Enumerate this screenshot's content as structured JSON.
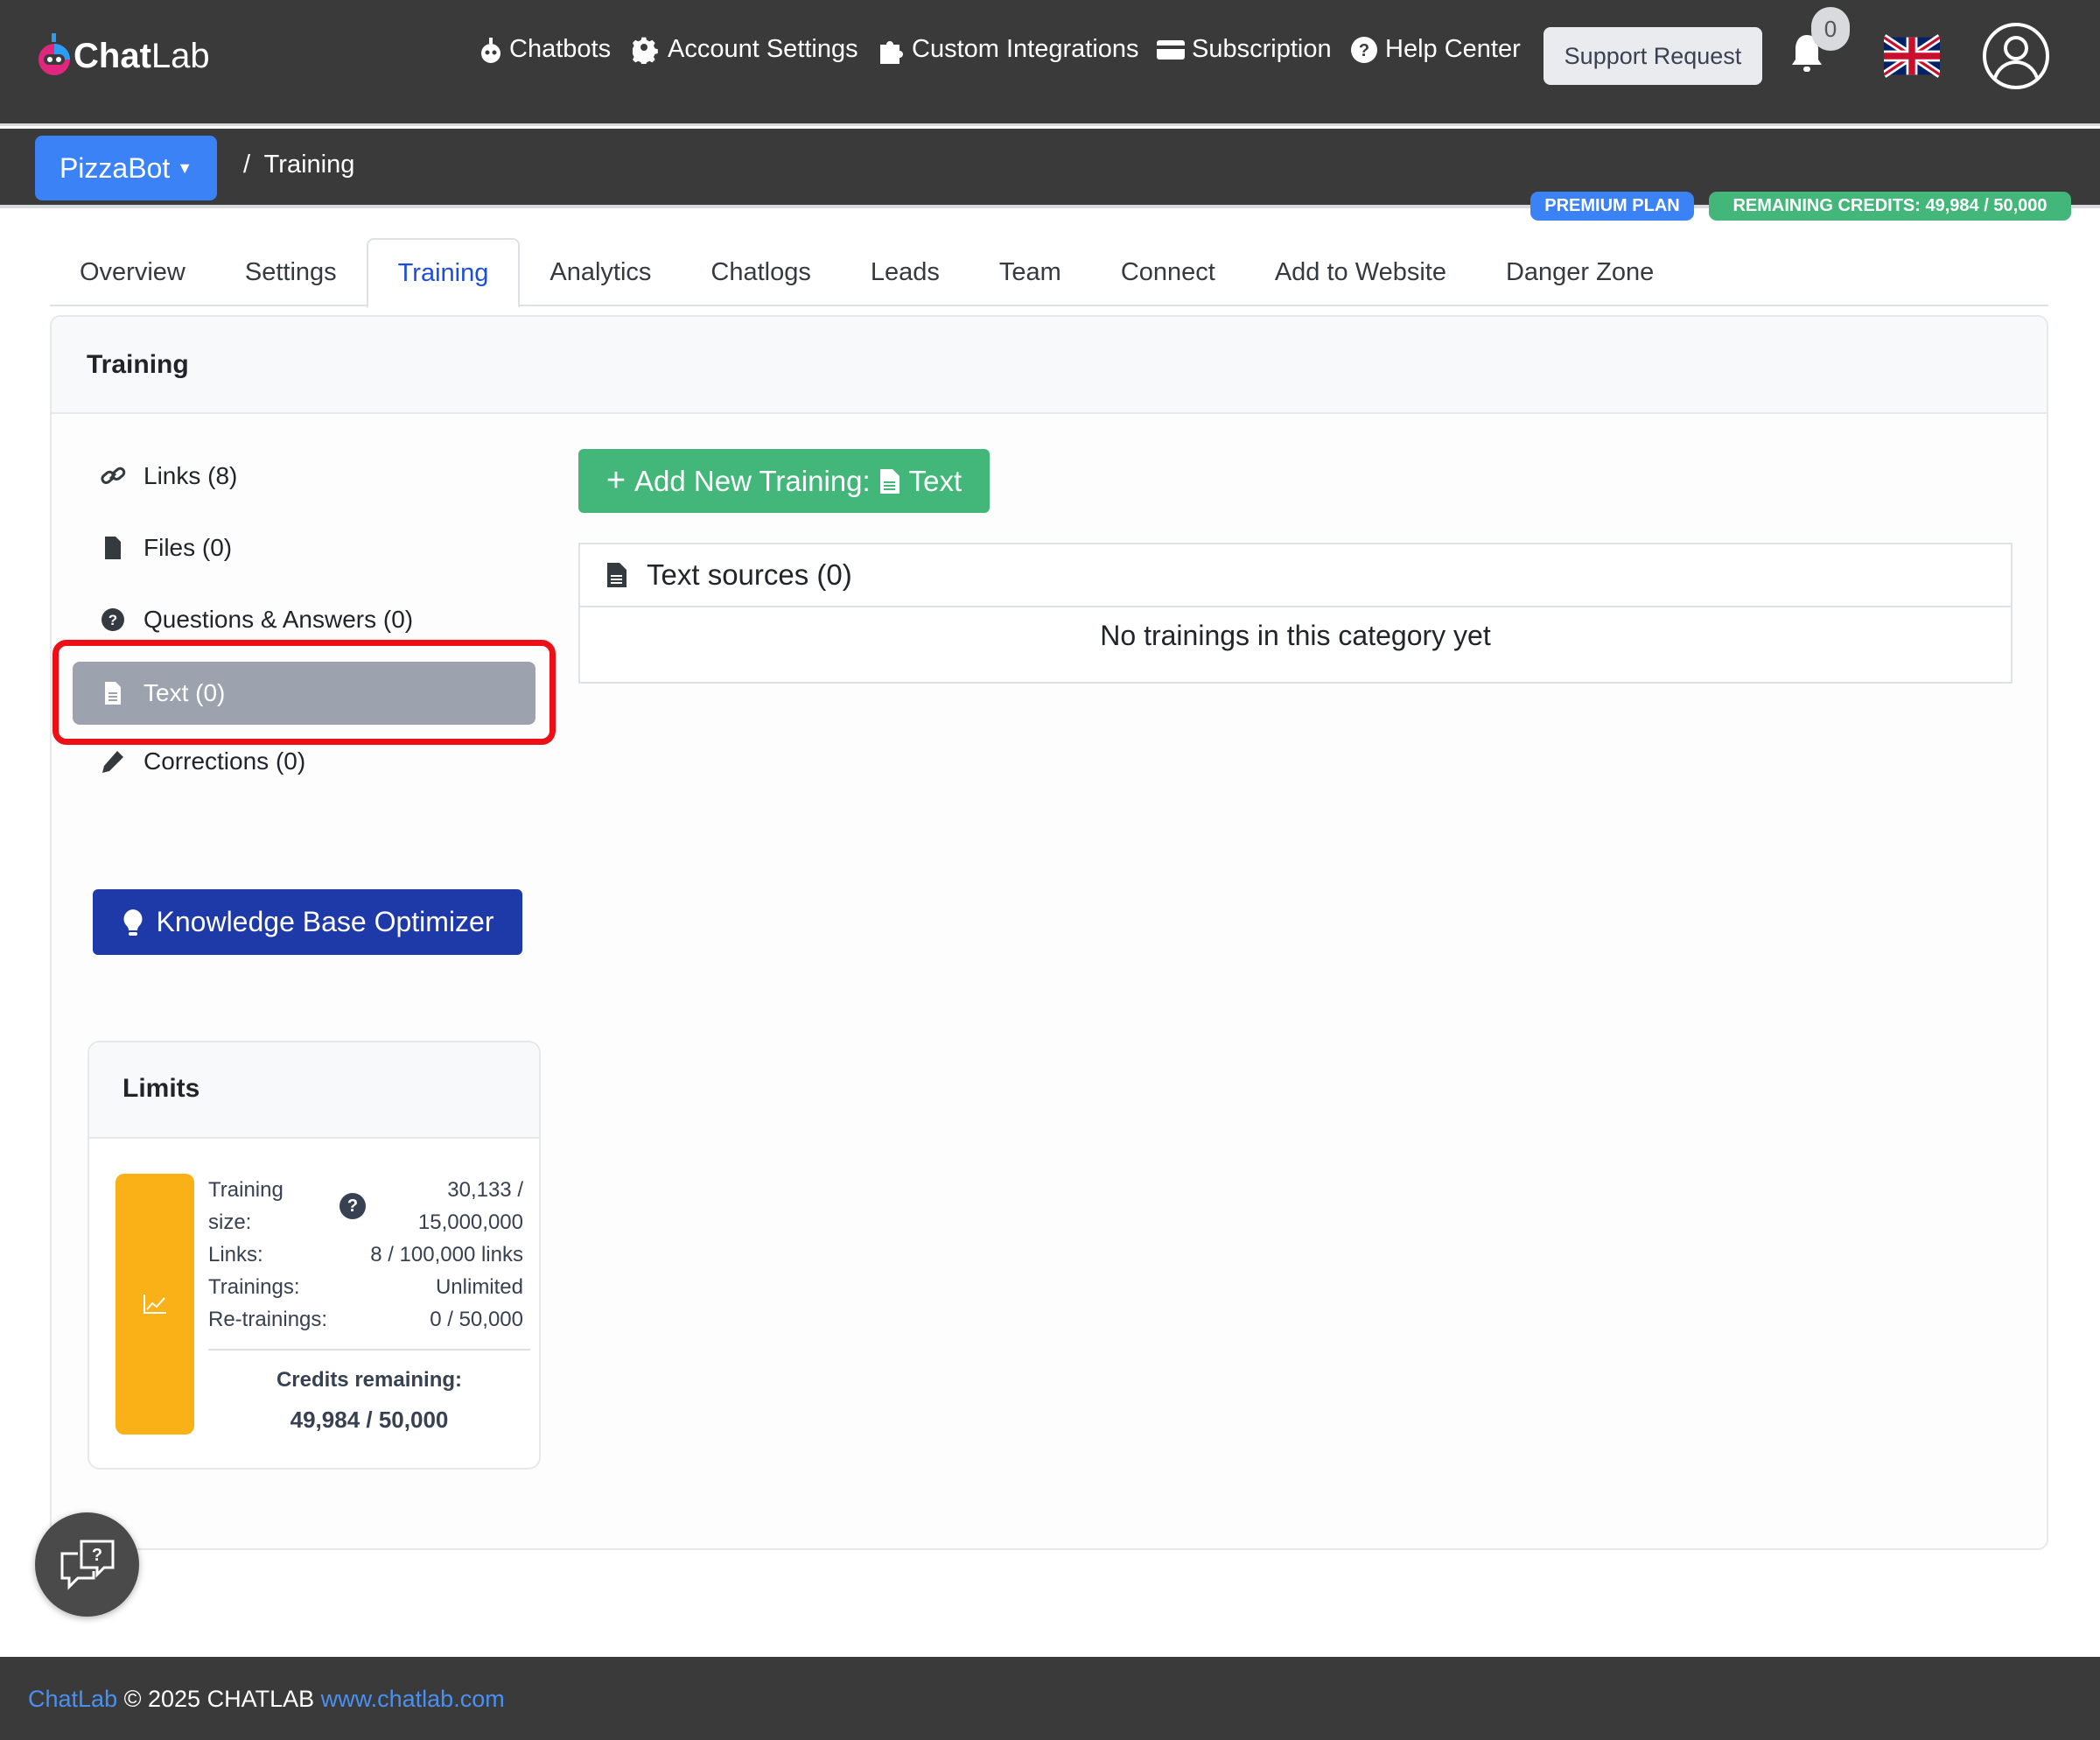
{
  "brand": {
    "name_bold": "Chat",
    "name_light": "Lab"
  },
  "nav": [
    {
      "label": "Chatbots",
      "icon": "robot-icon"
    },
    {
      "label": "Account Settings",
      "icon": "gear-icon"
    },
    {
      "label": "Custom Integrations",
      "icon": "puzzle-icon"
    },
    {
      "label": "Subscription",
      "icon": "credit-card-icon"
    },
    {
      "label": "Help Center",
      "icon": "question-circle-icon"
    }
  ],
  "support_label": "Support Request",
  "notifications_count": "0",
  "bot_selector": "PizzaBot",
  "breadcrumb": {
    "sep": "/",
    "current": "Training"
  },
  "badges": {
    "plan": "PREMIUM PLAN",
    "credits": "REMAINING CREDITS: 49,984 / 50,000"
  },
  "tabs": [
    "Overview",
    "Settings",
    "Training",
    "Analytics",
    "Chatlogs",
    "Leads",
    "Team",
    "Connect",
    "Add to Website",
    "Danger Zone"
  ],
  "card_title": "Training",
  "sidebar": [
    "Links (8)",
    "Files (0)",
    "Questions & Answers (0)",
    "Text (0)",
    "Corrections (0)"
  ],
  "kbo_label": "Knowledge Base Optimizer",
  "limits": {
    "title": "Limits",
    "rows": [
      {
        "label": "Training size:",
        "value": "30,133 / 15,000,000"
      },
      {
        "label": "Links:",
        "value": "8 / 100,000 links"
      },
      {
        "label": "Trainings:",
        "value": "Unlimited"
      },
      {
        "label": "Re-trainings:",
        "value": "0 / 50,000"
      }
    ],
    "credits_label": "Credits remaining:",
    "credits_value": "49,984 / 50,000"
  },
  "add_training": {
    "prefix": "Add New Training:",
    "type": "Text"
  },
  "sources": {
    "title": "Text sources (0)",
    "empty": "No trainings in this category yet"
  },
  "footer": {
    "brand": "ChatLab",
    "copy": "© 2025 CHATLAB",
    "link": "www.chatlab.com"
  },
  "colors": {
    "primary": "#3b82f6",
    "success": "#43b77a",
    "dark": "#3a3a3a",
    "highlight": "#ee0f16",
    "warning": "#fab118"
  }
}
